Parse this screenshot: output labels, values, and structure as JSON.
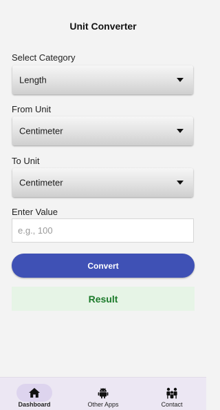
{
  "header": {
    "title": "Unit Converter"
  },
  "form": {
    "category": {
      "label": "Select Category",
      "selected": "Length"
    },
    "from_unit": {
      "label": "From Unit",
      "selected": "Centimeter"
    },
    "to_unit": {
      "label": "To Unit",
      "selected": "Centimeter"
    },
    "value": {
      "label": "Enter Value",
      "placeholder": "e.g., 100",
      "value": ""
    },
    "convert_label": "Convert"
  },
  "result": {
    "text": "Result"
  },
  "bottom_nav": {
    "active": "Dashboard",
    "items": [
      {
        "label": "Dashboard",
        "icon": "home-icon"
      },
      {
        "label": "Other Apps",
        "icon": "android-icon"
      },
      {
        "label": "Contact",
        "icon": "people-icon"
      }
    ]
  },
  "colors": {
    "accent": "#3f51b5",
    "result_bg": "#e6f4e6",
    "result_text": "#1b7a2a",
    "nav_bg": "#ece7f3",
    "nav_active_pill": "#ddd4ee"
  }
}
